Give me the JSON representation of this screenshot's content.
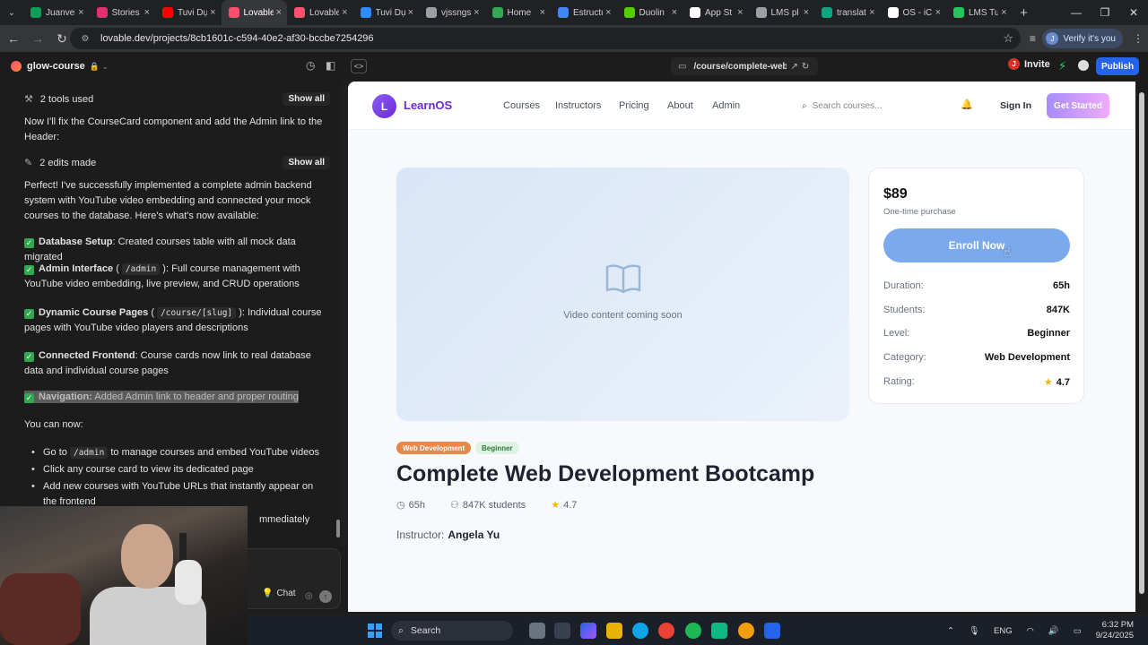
{
  "browser": {
    "tabs": [
      {
        "label": "Juanvel",
        "color": "#0f9d58",
        "active": false
      },
      {
        "label": "Stories",
        "color": "#e1306c",
        "active": false
      },
      {
        "label": "Tuvi Dự",
        "color": "#ff0000",
        "active": false
      },
      {
        "label": "Lovable",
        "color": "#ff4d6d",
        "active": true
      },
      {
        "label": "Lovable",
        "color": "#ff4d6d",
        "active": false
      },
      {
        "label": "Tuvi Dự",
        "color": "#2d8cff",
        "active": false
      },
      {
        "label": "vjssngs",
        "color": "#9aa0a6",
        "active": false
      },
      {
        "label": "Home",
        "color": "#34a853",
        "active": false
      },
      {
        "label": "Estructu",
        "color": "#4285f4",
        "active": false
      },
      {
        "label": "Duolin",
        "color": "#58cc02",
        "active": false
      },
      {
        "label": "App St",
        "color": "#ffffff",
        "active": false
      },
      {
        "label": "LMS pl",
        "color": "#9aa0a6",
        "active": false
      },
      {
        "label": "translat",
        "color": "#10a37f",
        "active": false
      },
      {
        "label": "OS - iC",
        "color": "#ffffff",
        "active": false
      },
      {
        "label": "LMS Tu",
        "color": "#22c55e",
        "active": false
      }
    ],
    "url": "lovable.dev/projects/8cb1601c-c594-40e2-af30-bccbe7254296",
    "verify_label": "Verify it's you",
    "verify_initial": "J"
  },
  "lovable": {
    "project_name": "glow-course",
    "route": "/course/complete-web-development-bootcamp",
    "invite_label": "Invite",
    "invite_initial": "J",
    "publish_label": "Publish",
    "chat": {
      "tools_used": "2 tools used",
      "show_all": "Show all",
      "msg1": "Now I'll fix the CourseCard component and add the Admin link to the Header:",
      "edits_made": "2 edits made",
      "summary": "Perfect! I've successfully implemented a complete admin backend system with YouTube video embedding and connected your mock courses to the database. Here's what's now available:",
      "items": [
        {
          "title": "Database Setup",
          "text": ": Created courses table with all mock data migrated"
        },
        {
          "title": "Admin Interface",
          "code": "/admin",
          "text": ": Full course management with YouTube video embedding, live preview, and CRUD operations"
        },
        {
          "title": "Dynamic Course Pages",
          "code": "/course/[slug]",
          "text": ": Individual course pages with YouTube video players and descriptions"
        },
        {
          "title": "Connected Frontend",
          "text": ": Course cards now link to real database data and individual course pages"
        },
        {
          "title": "Navigation:",
          "text": " Added Admin link to header and proper routing"
        }
      ],
      "you_can_now": "You can now:",
      "bullets": [
        {
          "pre": "Go to ",
          "code": "/admin",
          "post": " to manage courses and embed YouTube videos"
        },
        {
          "pre": "Click any course card to view its dedicated page",
          "code": "",
          "post": ""
        },
        {
          "pre": "Add new courses with YouTube URLs that instantly appear on the frontend",
          "code": "",
          "post": ""
        },
        {
          "pre": "mmediately",
          "code": "",
          "post": ""
        }
      ],
      "chat_button": "Chat"
    }
  },
  "site": {
    "logo_initial": "L",
    "logo_text": "LearnOS",
    "nav": [
      "Courses",
      "Instructors",
      "Pricing",
      "About",
      "Admin"
    ],
    "search_placeholder": "Search courses...",
    "sign_in": "Sign In",
    "get_started": "Get Started",
    "video_placeholder": "Video content coming soon",
    "price": "$89",
    "price_note": "One-time purchase",
    "enroll": "Enroll Now",
    "meta": [
      {
        "k": "Duration:",
        "v": "65h"
      },
      {
        "k": "Students:",
        "v": "847K"
      },
      {
        "k": "Level:",
        "v": "Beginner"
      },
      {
        "k": "Category:",
        "v": "Web Development"
      },
      {
        "k": "Rating:",
        "v": "4.7"
      }
    ],
    "badges": [
      "Web Development",
      "Beginner"
    ],
    "course_title": "Complete Web Development Bootcamp",
    "stats": {
      "duration": "65h",
      "students": "847K students",
      "rating": "4.7"
    },
    "instructor_label": "Instructor:",
    "instructor_name": "Angela Yu"
  },
  "taskbar": {
    "search": "Search",
    "lang": "ENG",
    "time": "6:32 PM",
    "date": "9/24/2025"
  }
}
